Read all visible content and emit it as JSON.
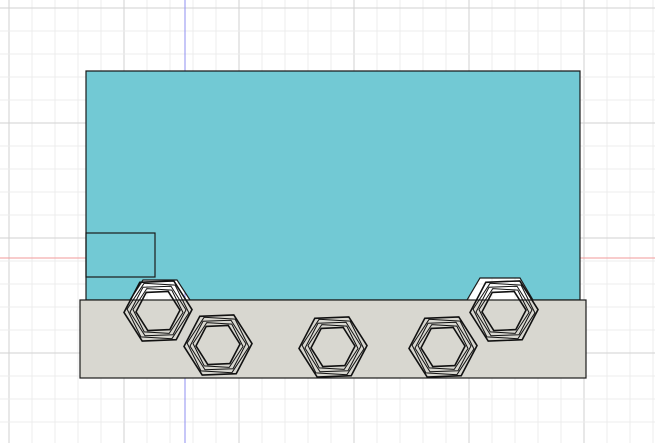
{
  "canvas": {
    "background": "#ffffff",
    "grid_minor_color": "#ececec",
    "grid_major_color": "#d2d2d2",
    "axis_vertical_color": "#8f8ff2",
    "axis_horizontal_color": "#f29a9a"
  },
  "sketch": {
    "top_face_color": "#72c9d4",
    "bottom_face_color": "#d8d7d0",
    "edge_color": "#1a1a1a",
    "hole_edge_color": "#111111",
    "hole_count": 5
  }
}
